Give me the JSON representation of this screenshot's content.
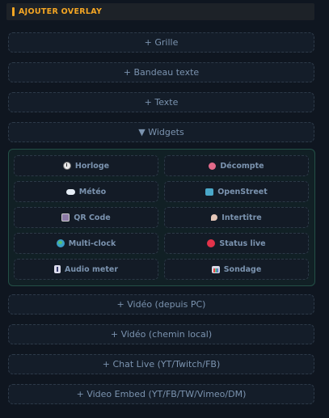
{
  "section": {
    "title": "AJOUTER OVERLAY"
  },
  "accordion": {
    "grid": "+ Grille",
    "banner": "+ Bandeau texte",
    "text": "+ Texte",
    "widgets": "▼ Widgets",
    "video_pc": "+ Vidéo (depuis PC)",
    "video_local": "+ Vidéo (chemin local)",
    "chat_live": "+ Chat Live (YT/Twitch/FB)",
    "video_embed": "+ Video Embed (YT/FB/TW/Vimeo/DM)"
  },
  "widgets": {
    "clock": {
      "label": "Horloge",
      "icon": "clock-icon"
    },
    "countdown": {
      "label": "Décompte",
      "icon": "alarm-clock-icon"
    },
    "weather": {
      "label": "Météo",
      "icon": "cloud-icon"
    },
    "openstreet": {
      "label": "OpenStreet",
      "icon": "map-icon"
    },
    "qrcode": {
      "label": "QR Code",
      "icon": "qr-icon"
    },
    "intertitle": {
      "label": "Intertitre",
      "icon": "pin-icon"
    },
    "multiclock": {
      "label": "Multi-clock",
      "icon": "globe-icon"
    },
    "status_live": {
      "label": "Status live",
      "icon": "red-dot-icon"
    },
    "audio_meter": {
      "label": "Audio meter",
      "icon": "meter-icon"
    },
    "poll": {
      "label": "Sondage",
      "icon": "chart-icon"
    }
  },
  "colors": {
    "accent": "#f5a623",
    "panel_border": "#235046",
    "text": "#7b93af"
  }
}
